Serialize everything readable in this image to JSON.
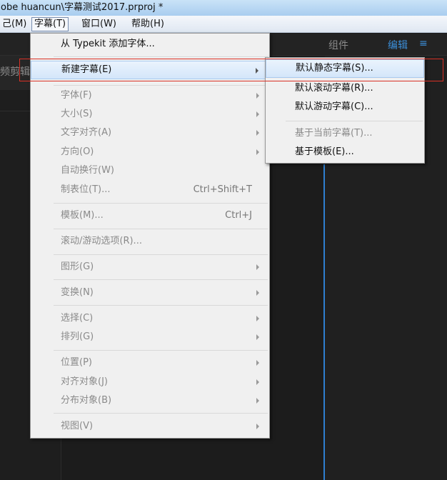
{
  "window": {
    "title": "obe huancun\\字幕测试2017.prproj *"
  },
  "menubar": [
    {
      "label": "己(M)"
    },
    {
      "label": "字幕(T)"
    },
    {
      "label": "窗口(W)"
    },
    {
      "label": "帮助(H)"
    }
  ],
  "panel": {
    "components_label": "组件",
    "edit_label": "编辑",
    "menu_glyph": "≡",
    "left_tab_label": "频剪辑"
  },
  "titles_menu": {
    "items": [
      {
        "label": "从 Typekit 添加字体...",
        "shortcut": "",
        "enabled": true,
        "submenu": false
      },
      {
        "label": "新建字幕(E)",
        "shortcut": "",
        "enabled": true,
        "submenu": true,
        "highlighted": true
      },
      {
        "label": "字体(F)",
        "shortcut": "",
        "enabled": false,
        "submenu": true
      },
      {
        "label": "大小(S)",
        "shortcut": "",
        "enabled": false,
        "submenu": true
      },
      {
        "label": "文字对齐(A)",
        "shortcut": "",
        "enabled": false,
        "submenu": true
      },
      {
        "label": "方向(O)",
        "shortcut": "",
        "enabled": false,
        "submenu": true
      },
      {
        "label": "自动换行(W)",
        "shortcut": "",
        "enabled": false,
        "submenu": false
      },
      {
        "label": "制表位(T)...",
        "shortcut": "Ctrl+Shift+T",
        "enabled": false,
        "submenu": false
      },
      {
        "label": "模板(M)...",
        "shortcut": "Ctrl+J",
        "enabled": false,
        "submenu": false
      },
      {
        "label": "滚动/游动选项(R)...",
        "shortcut": "",
        "enabled": false,
        "submenu": false
      },
      {
        "label": "图形(G)",
        "shortcut": "",
        "enabled": false,
        "submenu": true
      },
      {
        "label": "变换(N)",
        "shortcut": "",
        "enabled": false,
        "submenu": true
      },
      {
        "label": "选择(C)",
        "shortcut": "",
        "enabled": false,
        "submenu": true
      },
      {
        "label": "排列(G)",
        "shortcut": "",
        "enabled": false,
        "submenu": true
      },
      {
        "label": "位置(P)",
        "shortcut": "",
        "enabled": false,
        "submenu": true
      },
      {
        "label": "对齐对象(J)",
        "shortcut": "",
        "enabled": false,
        "submenu": true
      },
      {
        "label": "分布对象(B)",
        "shortcut": "",
        "enabled": false,
        "submenu": true
      },
      {
        "label": "视图(V)",
        "shortcut": "",
        "enabled": false,
        "submenu": true
      }
    ]
  },
  "new_title_submenu": {
    "items": [
      {
        "label": "默认静态字幕(S)...",
        "enabled": true,
        "highlighted": true
      },
      {
        "label": "默认滚动字幕(R)...",
        "enabled": true
      },
      {
        "label": "默认游动字幕(C)...",
        "enabled": true
      },
      {
        "label": "基于当前字幕(T)...",
        "enabled": false
      },
      {
        "label": "基于模板(E)...",
        "enabled": true
      }
    ]
  },
  "colors": {
    "accent_blue": "#3b8ed8",
    "highlight_red": "#d93025",
    "menu_bg": "#f0f0f0"
  }
}
